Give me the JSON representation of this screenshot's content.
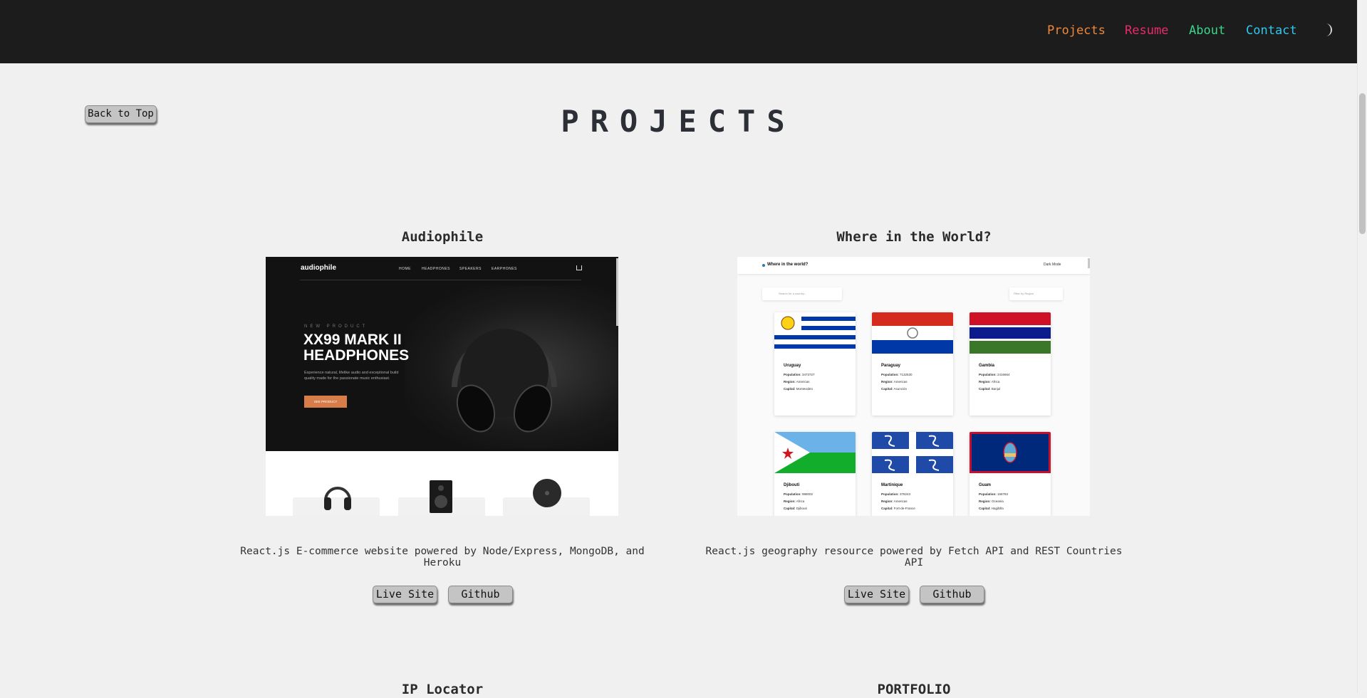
{
  "nav": {
    "links": [
      {
        "label": "Projects",
        "color": "#f0883a"
      },
      {
        "label": "Resume",
        "color": "#ea2a6d"
      },
      {
        "label": "About",
        "color": "#3ad78a"
      },
      {
        "label": "Contact",
        "color": "#2ec8ee"
      }
    ],
    "theme_toggle_icon": "moon-icon"
  },
  "page": {
    "title": "PROJECTS",
    "back_to_top": "Back to Top"
  },
  "projects": [
    {
      "title": "Audiophile",
      "description": "React.js E-commerce website powered by Node/Express, MongoDB, and Heroku",
      "live_label": "Live Site",
      "github_label": "Github",
      "screenshot": {
        "logo": "audiophile",
        "nav": [
          "HOME",
          "HEADPHONES",
          "SPEAKERS",
          "EARPHONES"
        ],
        "kicker": "NEW PRODUCT",
        "heading": "XX99 MARK II HEADPHONES",
        "body": "Experience natural, lifelike audio and exceptional build quality made for the passionate music enthusiast.",
        "cta": "SEE PRODUCT"
      }
    },
    {
      "title": "Where in the World?",
      "description": "React.js geography resource powered by Fetch API and REST Countries API",
      "live_label": "Live Site",
      "github_label": "Github",
      "screenshot": {
        "header_title": "Where in the world?",
        "dark_mode": "Dark Mode",
        "search_placeholder": "Search for a country...",
        "filter_placeholder": "Filter by Region",
        "countries": [
          {
            "name": "Uruguay",
            "population": "3473727",
            "region": "Americas",
            "capital": "Montevideo"
          },
          {
            "name": "Paraguay",
            "population": "7132530",
            "region": "Americas",
            "capital": "Asunción"
          },
          {
            "name": "Gambia",
            "population": "2416664",
            "region": "Africa",
            "capital": "Banjul"
          },
          {
            "name": "Djibouti",
            "population": "988002",
            "region": "Africa",
            "capital": "Djibouti"
          },
          {
            "name": "Martinique",
            "population": "378243",
            "region": "Americas",
            "capital": "Fort-de-France"
          },
          {
            "name": "Guam",
            "population": "168783",
            "region": "Oceania",
            "capital": "Hagåtña"
          }
        ],
        "labels": {
          "population": "Population:",
          "region": "Region:",
          "capital": "Capital:"
        }
      }
    },
    {
      "title": "IP Locator"
    },
    {
      "title": "PORTFOLIO"
    }
  ]
}
